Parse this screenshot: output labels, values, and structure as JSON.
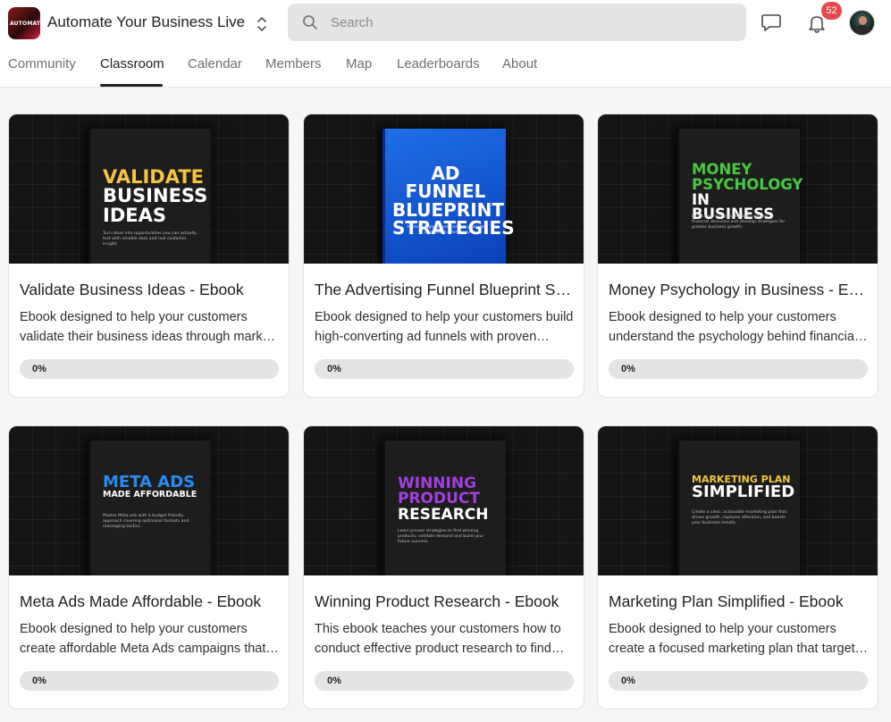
{
  "header": {
    "logo_text": "AUTOMATE",
    "group_name": "Automate Your Business Live",
    "search_placeholder": "Search",
    "notification_count": "52",
    "icons": [
      "switcher-icon",
      "search-icon",
      "chat-icon",
      "bell-icon"
    ]
  },
  "tabs": [
    {
      "label": "Community"
    },
    {
      "label": "Classroom",
      "active": true
    },
    {
      "label": "Calendar"
    },
    {
      "label": "Members"
    },
    {
      "label": "Map"
    },
    {
      "label": "Leaderboards"
    },
    {
      "label": "About"
    }
  ],
  "courses": [
    {
      "title": "Validate Business Ideas - Ebook",
      "description": "Ebook designed to help your customers validate their business ideas through market research",
      "progress_label": "0%",
      "progress": 0,
      "cover_lines": [
        "Validate",
        "Business",
        "Ideas"
      ],
      "cover_sub": "Turn ideas into opportunities you can actually test with reliable data and real customer insight.",
      "cover_colors": [
        "#f4c542",
        "#ffffff",
        "#ffffff"
      ]
    },
    {
      "title": "The Advertising Funnel Blueprint Strategies - Ebook",
      "description": "Ebook designed to help your customers build high-converting ad funnels with proven strategies",
      "progress_label": "0%",
      "progress": 0,
      "cover_lines": [
        "Ad Funnel",
        "Blueprint",
        "Strategies"
      ],
      "cover_sub": "Attract, engage, and convert your ideal customers effortlessly",
      "cover_colors": [
        "#ffffff",
        "#ffffff",
        "#ffffff"
      ]
    },
    {
      "title": "Money Psychology in Business - Ebook",
      "description": "Ebook designed to help your customers understand the psychology behind financial decisions",
      "progress_label": "0%",
      "progress": 0,
      "cover_lines": [
        "Money",
        "Psychology",
        "In Business"
      ],
      "cover_sub": "Learn how everyday thinking influences financial decisions and develop strategies for greater business growth.",
      "cover_colors": [
        "#47c83e",
        "#47c83e",
        "#ffffff"
      ]
    },
    {
      "title": "Meta Ads Made Affordable - Ebook",
      "description": "Ebook designed to help your customers create affordable Meta Ads campaigns that convert",
      "progress_label": "0%",
      "progress": 0,
      "cover_lines": [
        "Meta Ads",
        "Made Affordable"
      ],
      "cover_sub": "Master Meta ads with a budget friendly approach covering optimized formats and messaging tactics.",
      "cover_colors": [
        "#2a8cf0",
        "#ffffff"
      ]
    },
    {
      "title": "Winning Product Research - Ebook",
      "description": "This ebook teaches your customers how to conduct effective product research to find winners",
      "progress_label": "0%",
      "progress": 0,
      "cover_lines": [
        "Winning",
        "Product",
        "Research"
      ],
      "cover_sub": "Learn proven strategies to find winning products, validate demand and build your future success.",
      "cover_colors": [
        "#a43fe0",
        "#a43fe0",
        "#ffffff"
      ]
    },
    {
      "title": "Marketing Plan Simplified - Ebook",
      "description": "Ebook designed to help your customers create a focused marketing plan that targets results",
      "progress_label": "0%",
      "progress": 0,
      "cover_lines": [
        "Marketing Plan",
        "Simplified"
      ],
      "cover_sub": "Create a clear, actionable marketing plan that drives growth, captures attention, and boosts your business results.",
      "cover_colors": [
        "#f4c542",
        "#ffffff"
      ]
    }
  ]
}
